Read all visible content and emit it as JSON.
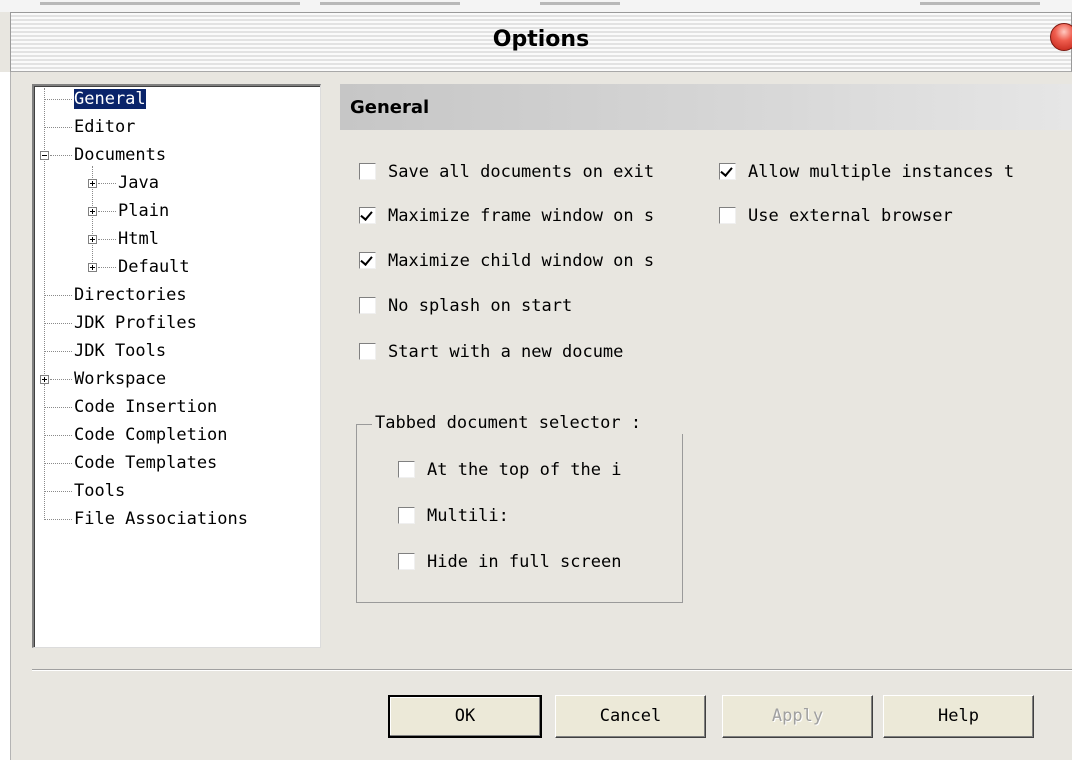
{
  "window": {
    "title": "Options"
  },
  "tree": {
    "items": [
      {
        "label": "General",
        "selected": true
      },
      {
        "label": "Editor"
      },
      {
        "label": "Documents",
        "expander": "minus"
      },
      {
        "label": "Java",
        "expander": "plus"
      },
      {
        "label": "Plain",
        "expander": "plus"
      },
      {
        "label": "Html",
        "expander": "plus"
      },
      {
        "label": "Default",
        "expander": "plus"
      },
      {
        "label": "Directories"
      },
      {
        "label": "JDK Profiles"
      },
      {
        "label": "JDK Tools"
      },
      {
        "label": "Workspace",
        "expander": "plus"
      },
      {
        "label": "Code Insertion"
      },
      {
        "label": "Code Completion"
      },
      {
        "label": "Code Templates"
      },
      {
        "label": "Tools"
      },
      {
        "label": "File Associations"
      }
    ]
  },
  "section": {
    "title": "General"
  },
  "options": {
    "save_all": {
      "label": "Save all documents on exit",
      "checked": false
    },
    "allow_multiple": {
      "label": "Allow multiple instances t",
      "checked": true
    },
    "maximize_frame": {
      "label": "Maximize frame window on s",
      "checked": true
    },
    "external_browser": {
      "label": "Use external browser",
      "checked": false
    },
    "maximize_child": {
      "label": "Maximize child window on s",
      "checked": true
    },
    "no_splash": {
      "label": "No splash on start",
      "checked": false
    },
    "new_document": {
      "label": "Start with a new docume",
      "checked": false
    }
  },
  "tab_selector": {
    "legend": "Tabbed document selector :",
    "top": {
      "label": "At the top of the i",
      "checked": false
    },
    "multiline": {
      "label": "Multili:",
      "checked": false
    },
    "hide_full": {
      "label": "Hide in full screen",
      "checked": false
    }
  },
  "buttons": {
    "ok": "OK",
    "cancel": "Cancel",
    "apply": "Apply",
    "help": "Help"
  },
  "colors": {
    "selection": "#0a246a",
    "close": "#ef5d4e",
    "face": "#e8e6e0"
  }
}
